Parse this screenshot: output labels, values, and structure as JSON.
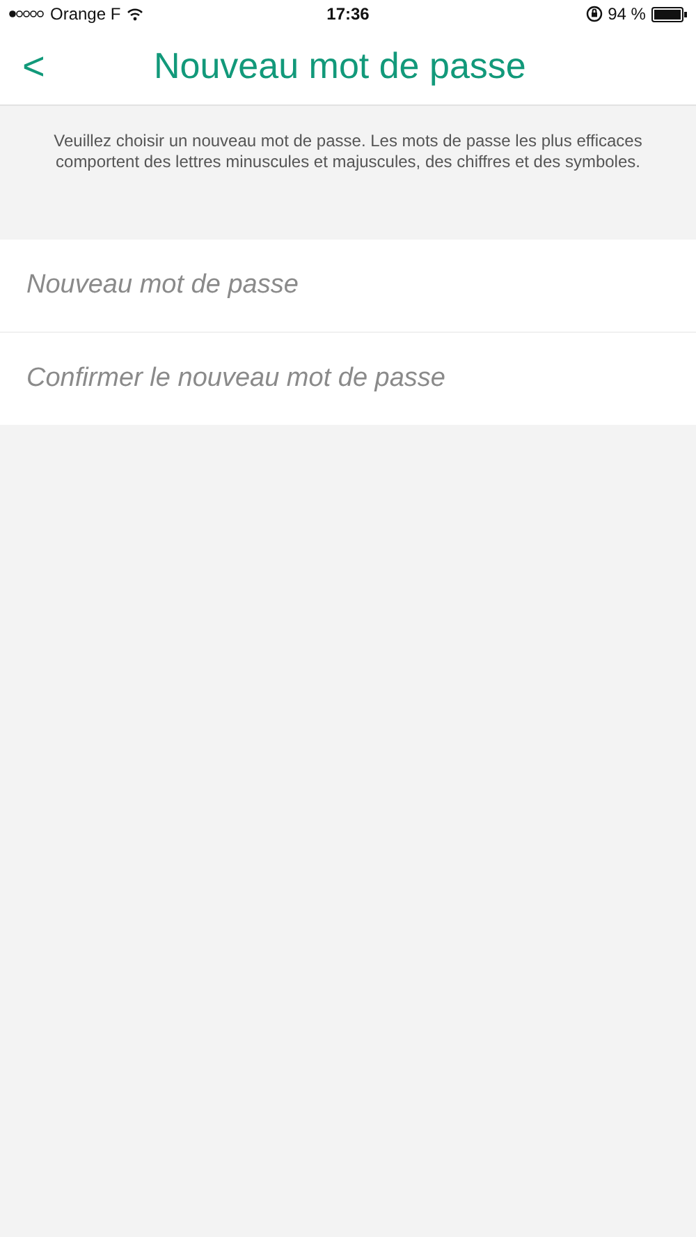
{
  "status_bar": {
    "carrier": "Orange F",
    "time": "17:36",
    "battery": "94 %"
  },
  "nav_bar": {
    "back": "<",
    "title": "Nouveau mot de passe"
  },
  "description": "Veuillez choisir un nouveau mot de passe. Les mots de passe les plus efficaces comportent des lettres minuscules et majuscules, des chiffres et des symboles.",
  "fields": [
    {
      "placeholder": "Nouveau mot de passe"
    },
    {
      "placeholder": "Confirmer le nouveau mot de passe"
    }
  ]
}
